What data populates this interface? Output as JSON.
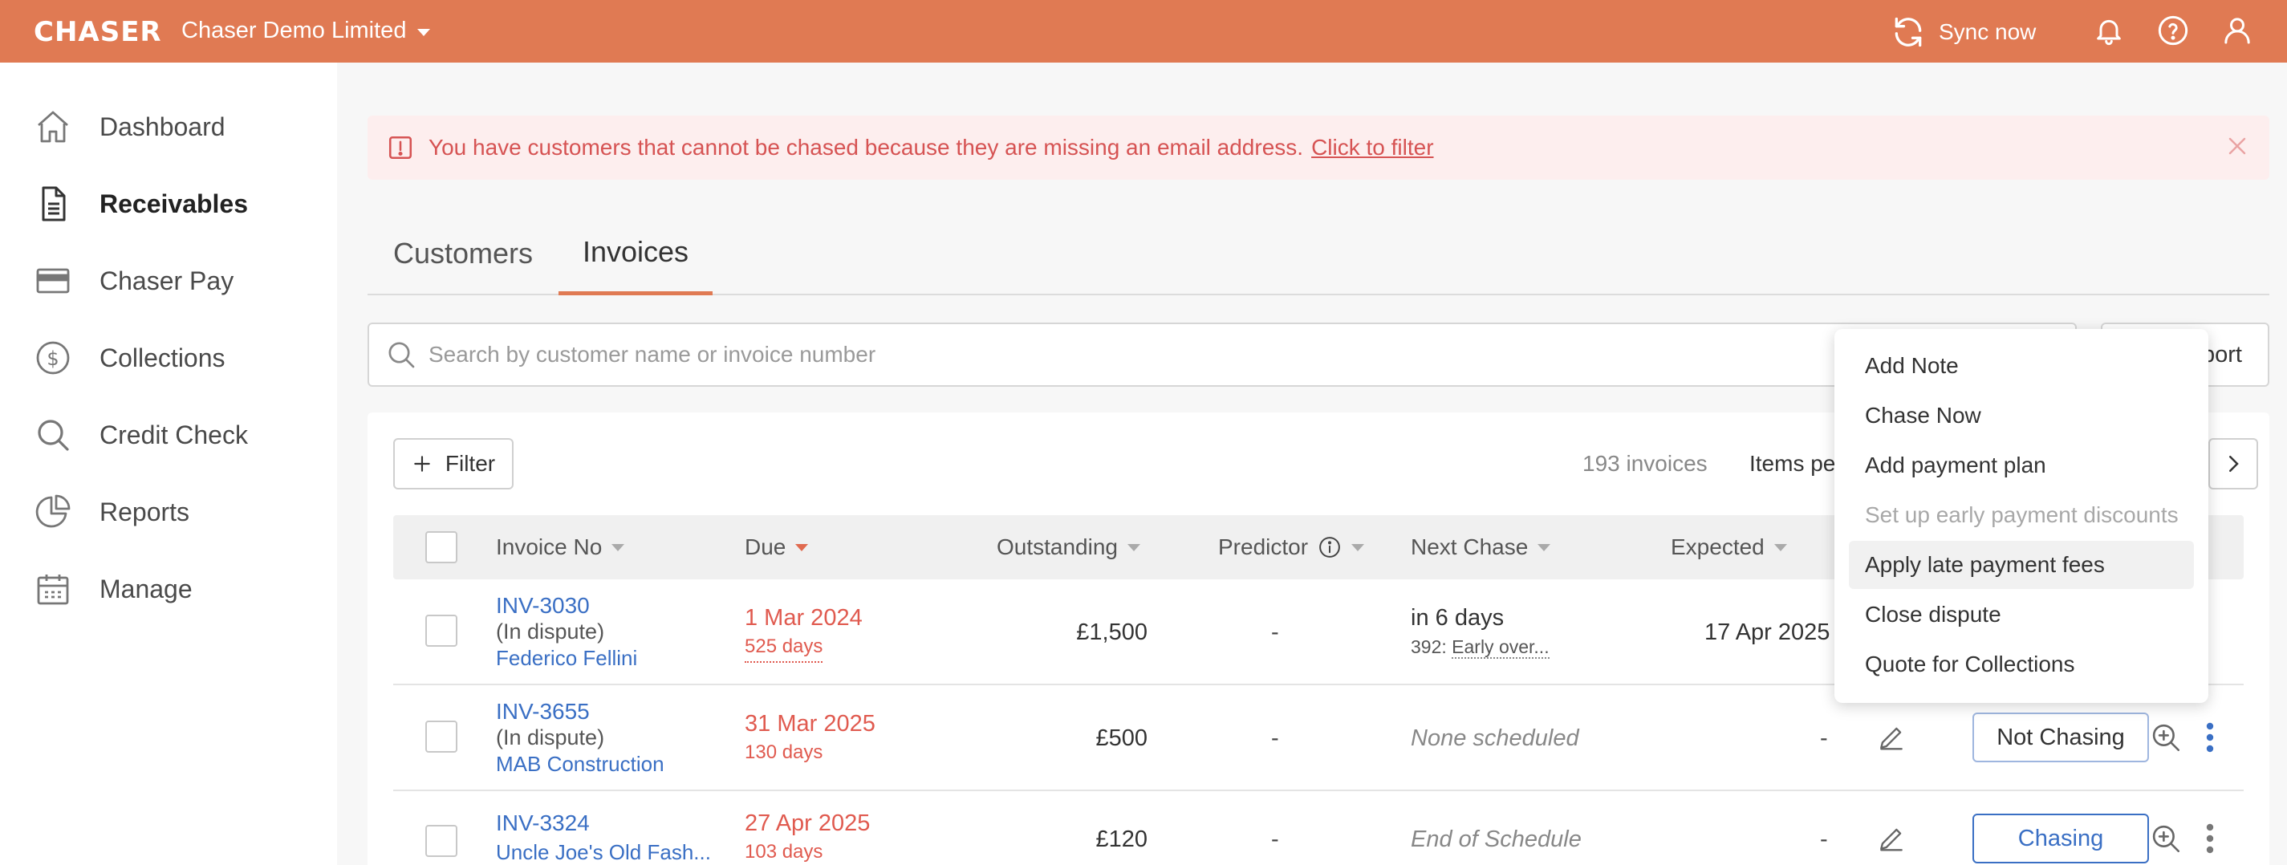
{
  "topbar": {
    "brand": "CHASER",
    "org_name": "Chaser Demo Limited",
    "sync_label": "Sync now",
    "icons": [
      "sync-icon",
      "bell-icon",
      "help-icon",
      "user-icon"
    ],
    "bg_color": "#e07a53"
  },
  "sidebar": {
    "items": [
      {
        "label": "Dashboard",
        "icon": "home-icon"
      },
      {
        "label": "Receivables",
        "icon": "document-icon",
        "active": true
      },
      {
        "label": "Chaser Pay",
        "icon": "card-icon"
      },
      {
        "label": "Collections",
        "icon": "dollar-icon"
      },
      {
        "label": "Credit Check",
        "icon": "search-icon"
      },
      {
        "label": "Reports",
        "icon": "pie-icon"
      },
      {
        "label": "Manage",
        "icon": "calendar-icon"
      }
    ]
  },
  "alert": {
    "message": "You have customers that cannot be chased because they are missing an email address.",
    "link": "Click to filter"
  },
  "tabs": [
    {
      "label": "Customers"
    },
    {
      "label": "Invoices",
      "active": true
    }
  ],
  "search": {
    "placeholder": "Search by customer name or invoice number"
  },
  "export_label": "port",
  "toolbar": {
    "filter_label": "Filter",
    "count": "193 invoices",
    "items_per_page_label": "Items pe"
  },
  "table": {
    "columns": [
      "Invoice No",
      "Due",
      "Outstanding",
      "Predictor",
      "Next Chase",
      "Expected"
    ],
    "rows": [
      {
        "invoice": "INV-3030",
        "dispute": "(In dispute)",
        "customer": "Federico Fellini",
        "due": "1 Mar 2024",
        "due_days": "525 days",
        "outstanding": "£1,500",
        "predictor": "-",
        "next_chase": "in 6 days",
        "next_chase_sub_prefix": "392:",
        "next_chase_sub": "Early over...",
        "expected": "17 Apr 2025"
      },
      {
        "invoice": "INV-3655",
        "dispute": "(In dispute)",
        "customer": "MAB Construction",
        "due": "31 Mar 2025",
        "due_days": "130 days",
        "outstanding": "£500",
        "predictor": "-",
        "next_chase": "None scheduled",
        "expected": "-",
        "status": "Not Chasing"
      },
      {
        "invoice": "INV-3324",
        "customer": "Uncle Joe's Old Fash...",
        "due": "27 Apr 2025",
        "due_days": "103 days",
        "outstanding": "£120",
        "predictor": "-",
        "next_chase": "End of Schedule",
        "expected": "-",
        "status": "Chasing"
      }
    ]
  },
  "menu": {
    "items": [
      {
        "label": "Add Note"
      },
      {
        "label": "Chase Now"
      },
      {
        "label": "Add payment plan"
      },
      {
        "label": "Set up early payment discounts",
        "disabled": true
      },
      {
        "label": "Apply late payment fees",
        "highlighted": true
      },
      {
        "label": "Close dispute"
      },
      {
        "label": "Quote for Collections"
      }
    ]
  },
  "colors": {
    "accent": "#e07a53",
    "link": "#3a6fc4",
    "overdue": "#e05a4f",
    "alert_bg": "#fdeeee"
  }
}
